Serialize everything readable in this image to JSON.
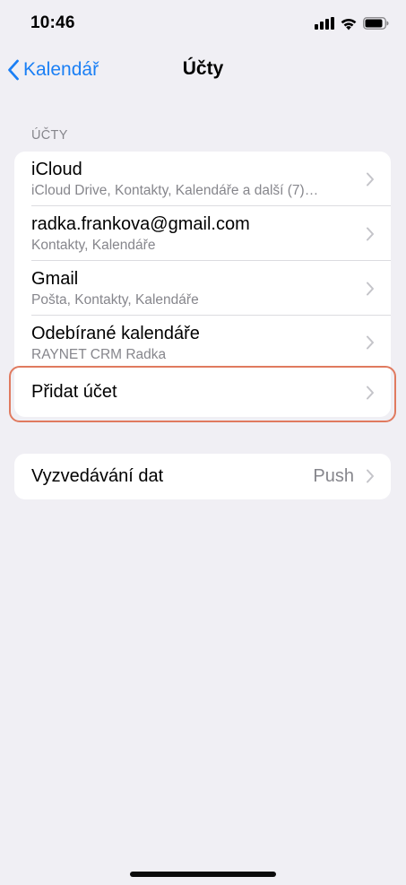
{
  "status": {
    "time": "10:46"
  },
  "nav": {
    "back_label": "Kalendář",
    "title": "Účty"
  },
  "accounts_section": {
    "header": "ÚČTY",
    "rows": [
      {
        "title": "iCloud",
        "subtitle": "iCloud Drive, Kontakty, Kalendáře a další (7)…"
      },
      {
        "title": "radka.frankova@gmail.com",
        "subtitle": "Kontakty, Kalendáře"
      },
      {
        "title": "Gmail",
        "subtitle": "Pošta, Kontakty, Kalendáře"
      },
      {
        "title": "Odebírané kalendáře",
        "subtitle": "RAYNET CRM Radka"
      },
      {
        "title": "Přidat účet"
      }
    ]
  },
  "fetch_row": {
    "title": "Vyzvedávání dat",
    "value": "Push"
  },
  "colors": {
    "accent": "#1a7ff5",
    "highlight": "#e07a5f",
    "background": "#f0eff4"
  },
  "icons": [
    "chevron-left-icon",
    "signal-icon",
    "wifi-icon",
    "battery-icon",
    "chevron-right-icon"
  ]
}
